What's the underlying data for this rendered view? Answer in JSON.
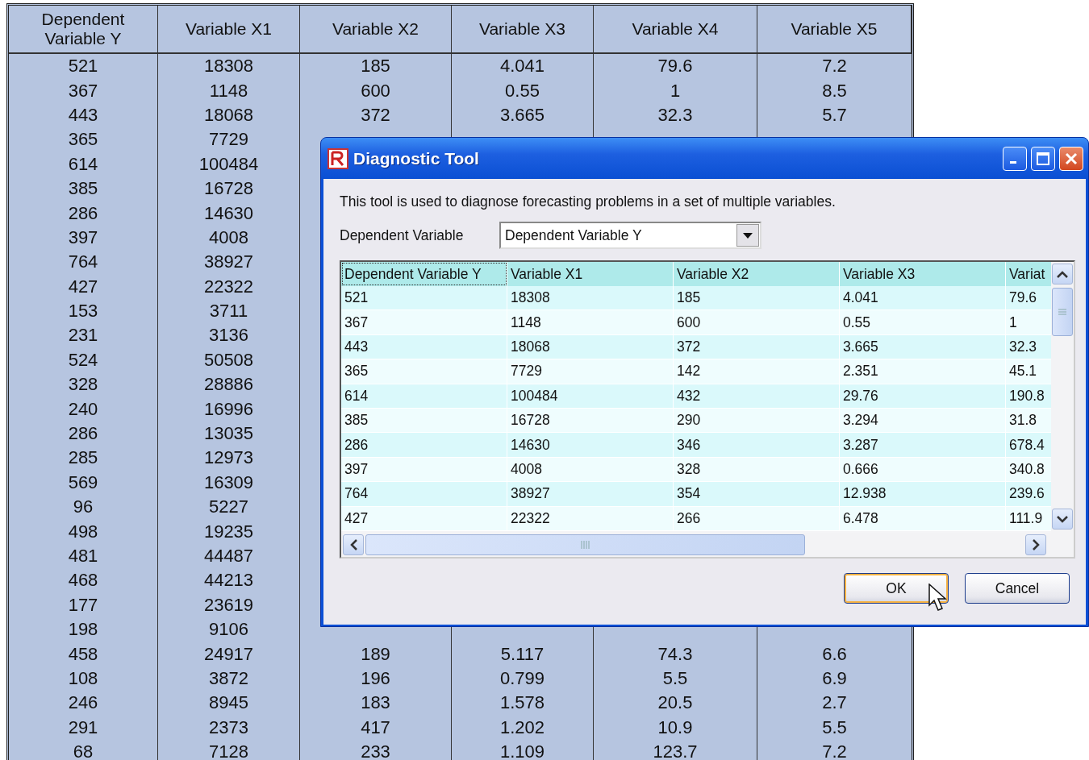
{
  "background_table": {
    "columns": [
      "Dependent Variable Y",
      "Variable X1",
      "Variable X2",
      "Variable X3",
      "Variable X4",
      "Variable X5"
    ],
    "rows": [
      [
        "521",
        "18308",
        "185",
        "4.041",
        "79.6",
        "7.2"
      ],
      [
        "367",
        "1148",
        "600",
        "0.55",
        "1",
        "8.5"
      ],
      [
        "443",
        "18068",
        "372",
        "3.665",
        "32.3",
        "5.7"
      ],
      [
        "365",
        "7729"
      ],
      [
        "614",
        "100484"
      ],
      [
        "385",
        "16728"
      ],
      [
        "286",
        "14630"
      ],
      [
        "397",
        "4008"
      ],
      [
        "764",
        "38927"
      ],
      [
        "427",
        "22322"
      ],
      [
        "153",
        "3711"
      ],
      [
        "231",
        "3136"
      ],
      [
        "524",
        "50508"
      ],
      [
        "328",
        "28886"
      ],
      [
        "240",
        "16996"
      ],
      [
        "286",
        "13035"
      ],
      [
        "285",
        "12973"
      ],
      [
        "569",
        "16309"
      ],
      [
        "96",
        "5227"
      ],
      [
        "498",
        "19235"
      ],
      [
        "481",
        "44487"
      ],
      [
        "468",
        "44213"
      ],
      [
        "177",
        "23619"
      ],
      [
        "198",
        "9106"
      ],
      [
        "458",
        "24917",
        "189",
        "5.117",
        "74.3",
        "6.6"
      ],
      [
        "108",
        "3872",
        "196",
        "0.799",
        "5.5",
        "6.9"
      ],
      [
        "246",
        "8945",
        "183",
        "1.578",
        "20.5",
        "2.7"
      ],
      [
        "291",
        "2373",
        "417",
        "1.202",
        "10.9",
        "5.5"
      ],
      [
        "68",
        "7128",
        "233",
        "1.109",
        "123.7",
        "7.2"
      ]
    ]
  },
  "dialog": {
    "title": "Diagnostic Tool",
    "description": "This tool is used to diagnose forecasting problems in a set of multiple variables.",
    "field_label": "Dependent Variable",
    "dropdown_value": "Dependent Variable Y",
    "grid": {
      "columns": [
        "Dependent Variable Y",
        "Variable X1",
        "Variable X2",
        "Variable X3",
        "Variat"
      ],
      "rows": [
        [
          "521",
          "18308",
          "185",
          "4.041",
          "79.6"
        ],
        [
          "367",
          "1148",
          "600",
          "0.55",
          "1"
        ],
        [
          "443",
          "18068",
          "372",
          "3.665",
          "32.3"
        ],
        [
          "365",
          "7729",
          "142",
          "2.351",
          "45.1"
        ],
        [
          "614",
          "100484",
          "432",
          "29.76",
          "190.8"
        ],
        [
          "385",
          "16728",
          "290",
          "3.294",
          "31.8"
        ],
        [
          "286",
          "14630",
          "346",
          "3.287",
          "678.4"
        ],
        [
          "397",
          "4008",
          "328",
          "0.666",
          "340.8"
        ],
        [
          "764",
          "38927",
          "354",
          "12.938",
          "239.6"
        ],
        [
          "427",
          "22322",
          "266",
          "6.478",
          "111.9"
        ]
      ]
    },
    "buttons": [
      {
        "label": "OK",
        "default": true
      },
      {
        "label": "Cancel",
        "default": false
      }
    ]
  }
}
